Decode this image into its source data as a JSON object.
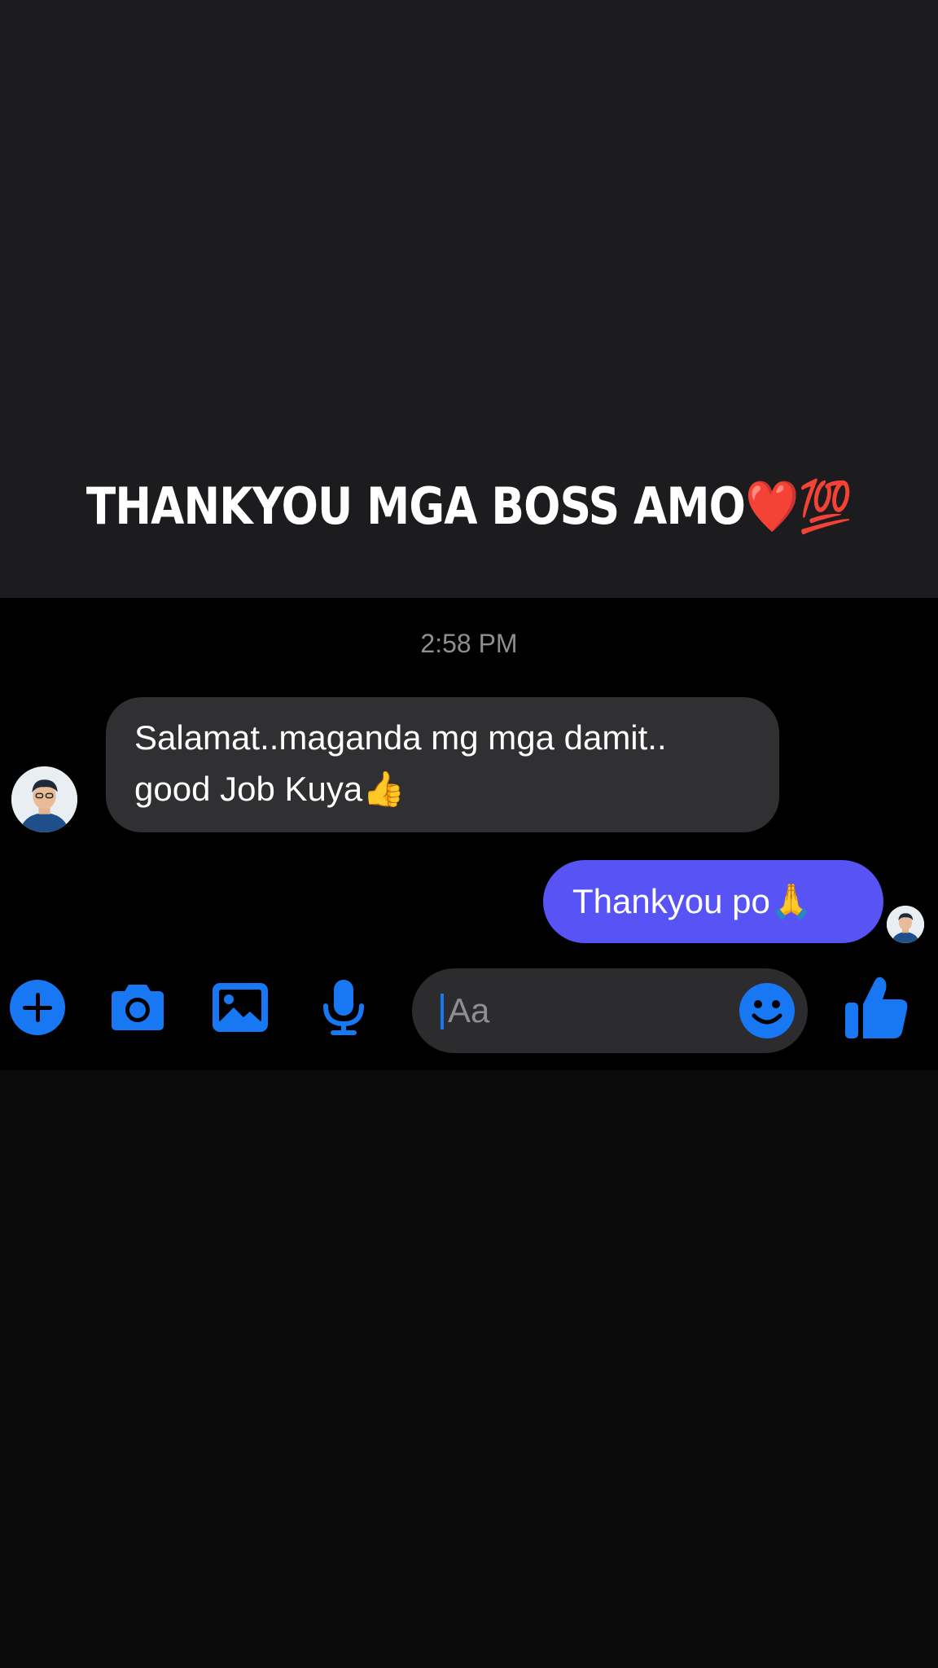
{
  "story": {
    "caption": "THANKYOU MGA BOSS AMO❤️💯"
  },
  "conversation": {
    "timestamp": "2:58 PM",
    "messages": [
      {
        "direction": "incoming",
        "lines": [
          "Salamat..maganda mg mga damit..",
          "good Job Kuya👍"
        ]
      },
      {
        "direction": "outgoing",
        "lines": [
          "Thankyou po🙏"
        ]
      }
    ]
  },
  "composer": {
    "placeholder": "Aa",
    "icons": [
      "plus-icon",
      "camera-icon",
      "gallery-icon",
      "microphone-icon",
      "emoji-icon",
      "thumbs-up-icon"
    ]
  },
  "colors": {
    "accent": "#1877f2",
    "outgoing_bubble": "#5753f5",
    "incoming_bubble": "#303033",
    "top_background": "#1c1c1e",
    "chat_background": "#000000"
  }
}
